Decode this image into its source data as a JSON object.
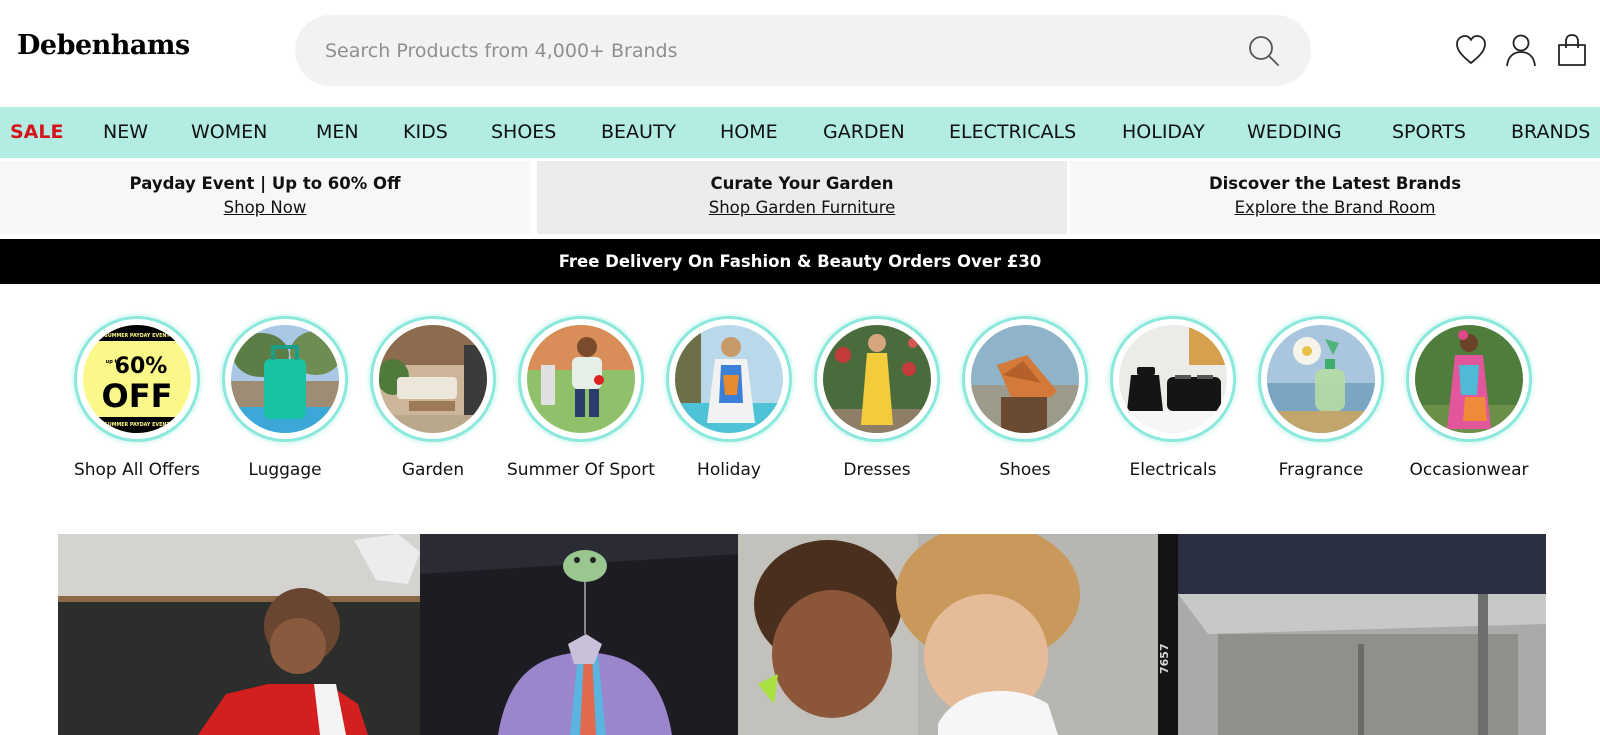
{
  "header": {
    "logo": "Debenhams",
    "search": {
      "placeholder": "Search Products from 4,000+ Brands",
      "value": ""
    },
    "icons": [
      "search-icon",
      "heart-icon",
      "user-icon",
      "bag-icon"
    ]
  },
  "nav": {
    "items": [
      "SALE",
      "NEW",
      "WOMEN",
      "MEN",
      "KIDS",
      "SHOES",
      "BEAUTY",
      "HOME",
      "GARDEN",
      "ELECTRICALS",
      "HOLIDAY",
      "WEDDING",
      "SPORTS",
      "BRANDS"
    ]
  },
  "promos": [
    {
      "title": "Payday Event | Up to 60% Off",
      "link": "Shop Now"
    },
    {
      "title": "Curate Your Garden",
      "link": "Shop Garden Furniture"
    },
    {
      "title": "Discover the Latest Brands",
      "link": "Explore the Brand Room"
    }
  ],
  "delivery": "Free Delivery On Fashion & Beauty Orders Over £30",
  "categories": [
    {
      "label": "Shop All Offers",
      "badge": {
        "upto": "up to",
        "pct": "60%",
        "off": "OFF",
        "top": "SUMMER PAYDAY EVENT",
        "bottom": "SUMMER PAYDAY EVENT"
      }
    },
    {
      "label": "Luggage"
    },
    {
      "label": "Garden"
    },
    {
      "label": "Summer Of Sport"
    },
    {
      "label": "Holiday"
    },
    {
      "label": "Dresses"
    },
    {
      "label": "Shoes"
    },
    {
      "label": "Electricals"
    },
    {
      "label": "Fragrance"
    },
    {
      "label": "Occasionwear"
    }
  ],
  "hero": {
    "number": "7657"
  },
  "colors": {
    "nav_bg": "#b2ece3",
    "sale": "#d5131b",
    "ring": "#8ce8dd",
    "badge_yellow": "#fbf88a"
  }
}
